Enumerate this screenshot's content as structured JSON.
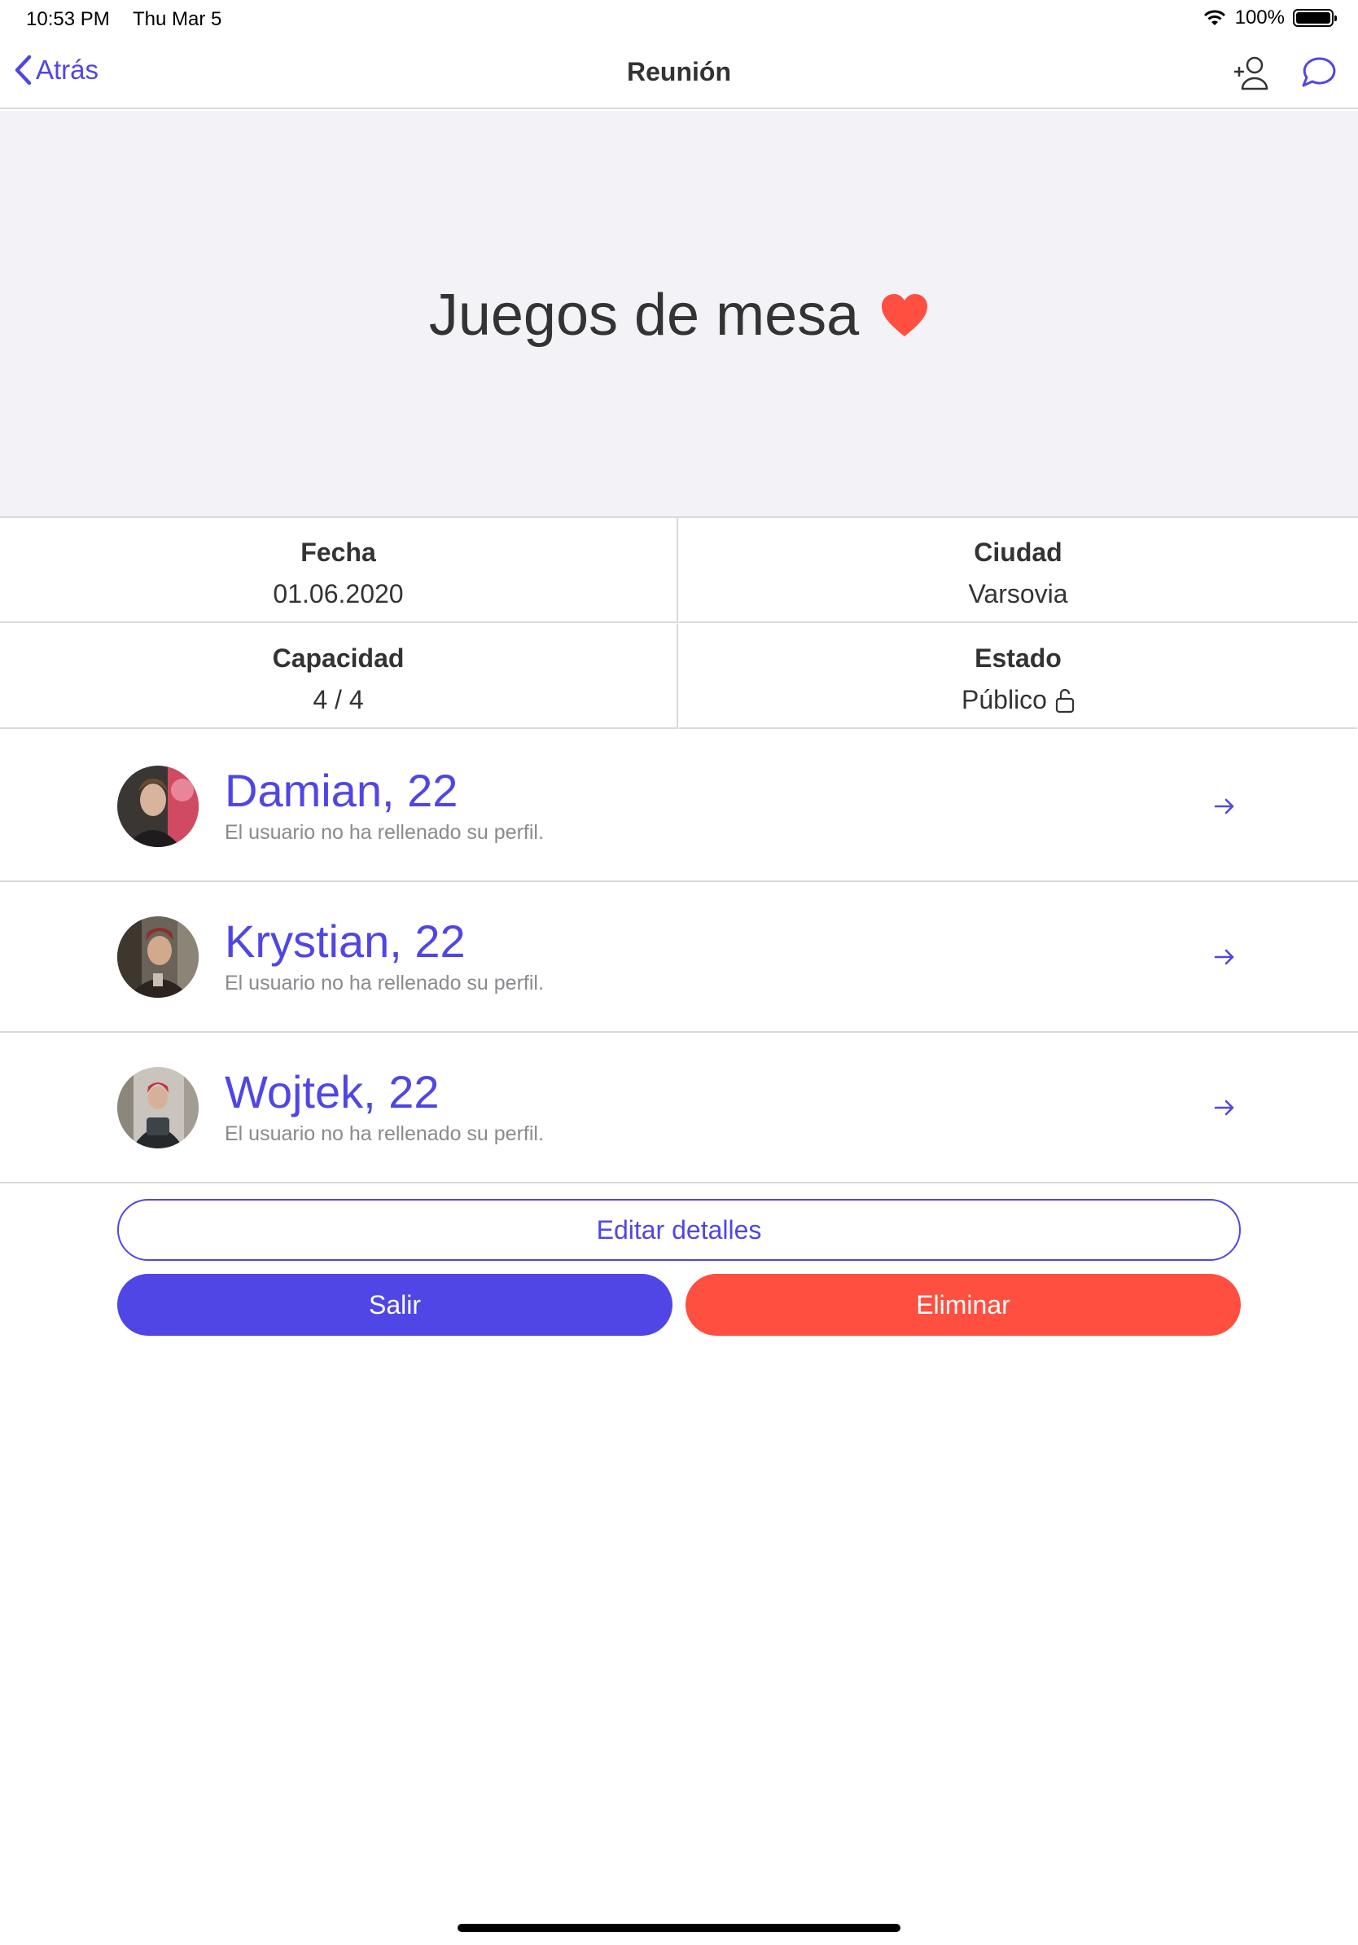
{
  "status_bar": {
    "time": "10:53 PM",
    "date": "Thu Mar 5",
    "battery": "100%"
  },
  "nav": {
    "back_label": "Atrás",
    "title": "Reunión",
    "icons": [
      "add-person-icon",
      "chat-icon"
    ]
  },
  "hero": {
    "title": "Juegos de mesa",
    "icon": "heart-icon",
    "icon_color": "#ff4f40"
  },
  "info": {
    "date_label": "Fecha",
    "date_value": "01.06.2020",
    "city_label": "Ciudad",
    "city_value": "Varsovia",
    "capacity_label": "Capacidad",
    "capacity_value": "4 / 4",
    "status_label": "Estado",
    "status_value": "Público"
  },
  "members": [
    {
      "name": "Damian, 22",
      "subtitle": "El usuario no ha rellenado su perfil."
    },
    {
      "name": "Krystian, 22",
      "subtitle": "El usuario no ha rellenado su perfil."
    },
    {
      "name": "Wojtek, 22",
      "subtitle": "El usuario no ha rellenado su perfil."
    }
  ],
  "actions": {
    "edit_label": "Editar detalles",
    "leave_label": "Salir",
    "delete_label": "Eliminar"
  },
  "colors": {
    "accent": "#5046e5",
    "danger": "#ff4f40",
    "hero_bg": "#f2f2f7"
  }
}
